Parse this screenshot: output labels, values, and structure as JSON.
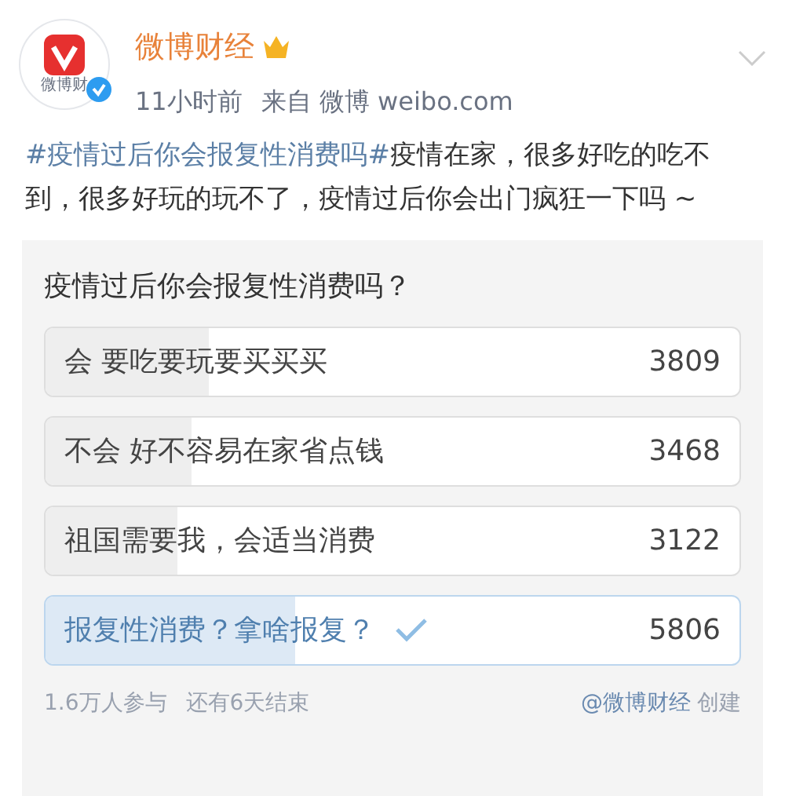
{
  "author": {
    "name": "微博财经",
    "avatar_label": "微博财",
    "verified": true
  },
  "meta": {
    "time": "11小时前",
    "source": "来自 微博 weibo.com"
  },
  "post": {
    "hashtag": "#疫情过后你会报复性消费吗#",
    "text": "疫情在家，很多好吃的吃不到，很多好玩的玩不了，疫情过后你会出门疯狂一下吗 ~"
  },
  "poll": {
    "question": "疫情过后你会报复性消费吗？",
    "options": [
      {
        "label": "会 要吃要玩要买买买",
        "count": "3809",
        "level": 0.235,
        "selected": false
      },
      {
        "label": "不会 好不容易在家省点钱",
        "count": "3468",
        "level": 0.21,
        "selected": false
      },
      {
        "label": "祖国需要我，会适当消费",
        "count": "3122",
        "level": 0.19,
        "selected": false
      },
      {
        "label": "报复性消费？拿啥报复？",
        "count": "5806",
        "level": 0.36,
        "selected": true
      }
    ],
    "participants": "1.6万人参与",
    "remaining": "还有6天结束",
    "creator": "@微博财经",
    "created": "创建"
  }
}
